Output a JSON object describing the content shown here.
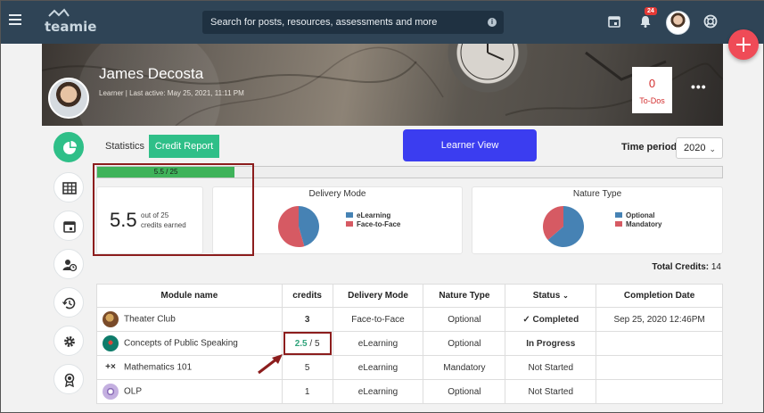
{
  "header": {
    "logo_text": "teamie",
    "search_placeholder": "Search for posts, resources, assessments and more",
    "notification_count": "24"
  },
  "profile": {
    "name": "James Decosta",
    "meta": "Learner | Last active: May 25, 2021, 11:11 PM",
    "todos_count": "0",
    "todos_label": "To-Dos",
    "more_label": "•••"
  },
  "tabs": [
    {
      "label": "Statistics",
      "active": false
    },
    {
      "label": "Credit Report",
      "active": true
    }
  ],
  "learner_view_label": "Learner View",
  "time_period": {
    "label": "Time period:",
    "value": "2020"
  },
  "progress": {
    "label": "5.5 / 25",
    "fraction": 0.22
  },
  "credits_earned": {
    "value": "5.5",
    "out_of": "out of 25",
    "caption": "credits earned"
  },
  "delivery_mode": {
    "title": "Delivery Mode",
    "legend": [
      {
        "label": "eLearning",
        "color": "#4682b4"
      },
      {
        "label": "Face-to-Face",
        "color": "#d65a63"
      }
    ]
  },
  "nature_type": {
    "title": "Nature Type",
    "legend": [
      {
        "label": "Optional",
        "color": "#4682b4"
      },
      {
        "label": "Mandatory",
        "color": "#d65a63"
      }
    ]
  },
  "chart_data": [
    {
      "type": "pie",
      "title": "Delivery Mode",
      "labels": [
        "eLearning",
        "Face-to-Face"
      ],
      "values": [
        2.5,
        3
      ],
      "colors": [
        "#4682b4",
        "#d65a63"
      ]
    },
    {
      "type": "pie",
      "title": "Nature Type",
      "labels": [
        "Optional",
        "Mandatory"
      ],
      "values": [
        3.5,
        2
      ],
      "colors": [
        "#4682b4",
        "#d65a63"
      ]
    }
  ],
  "total_credits": {
    "label": "Total Credits:",
    "value": "14"
  },
  "table": {
    "headers": [
      "Module name",
      "credits",
      "Delivery Mode",
      "Nature Type",
      "Status",
      "Completion Date"
    ],
    "status_sort_icon": "chevron-down-icon",
    "rows": [
      {
        "name": "Theater Club",
        "credits": "3",
        "credits_total": "",
        "delivery": "Face-to-Face",
        "nature": "Optional",
        "status": "Completed",
        "date": "Sep 25, 2020 12:46PM",
        "icon_color": "#7a4b2a"
      },
      {
        "name": "Concepts of Public Speaking",
        "credits": "2.5",
        "credits_total": "/ 5",
        "delivery": "eLearning",
        "nature": "Optional",
        "status": "In Progress",
        "date": "",
        "icon_color": "#0f7c6b"
      },
      {
        "name": "Mathematics 101",
        "credits": "5",
        "credits_total": "",
        "delivery": "eLearning",
        "nature": "Mandatory",
        "status": "Not Started",
        "date": "",
        "icon_color": "#ffffff"
      },
      {
        "name": "OLP",
        "credits": "1",
        "credits_total": "",
        "delivery": "eLearning",
        "nature": "Optional",
        "status": "Not Started",
        "date": "",
        "icon_color": "#b59ad6"
      }
    ]
  },
  "colors": {
    "topbar": "#2f4456",
    "accent_green": "#2fbf88",
    "learner_view": "#3b3df0",
    "fab": "#ef4b57",
    "highlight": "#8c1d1d"
  }
}
